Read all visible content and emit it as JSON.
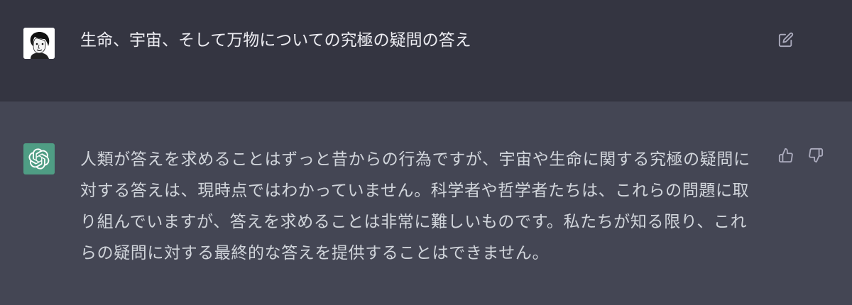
{
  "user_message": {
    "avatar_icon": "user-portrait-icon",
    "text": "生命、宇宙、そして万物についての究極の疑問の答え",
    "edit_icon": "edit-icon"
  },
  "assistant_message": {
    "avatar_icon": "openai-logo-icon",
    "text": "人類が答えを求めることはずっと昔からの行為ですが、宇宙や生命に関する究極の疑問に対する答えは、現時点ではわかっていません。科学者や哲学者たちは、これらの問題に取り組んでいますが、答えを求めることは非常に難しいものです。私たちが知る限り、これらの疑問に対する最終的な答えを提供することはできません。",
    "thumbs_up_icon": "thumbs-up-icon",
    "thumbs_down_icon": "thumbs-down-icon"
  },
  "colors": {
    "user_bg": "#343541",
    "assistant_bg": "#444654",
    "bot_avatar": "#4f9d84",
    "text": "#d1d5db",
    "icon": "#acacbe"
  }
}
